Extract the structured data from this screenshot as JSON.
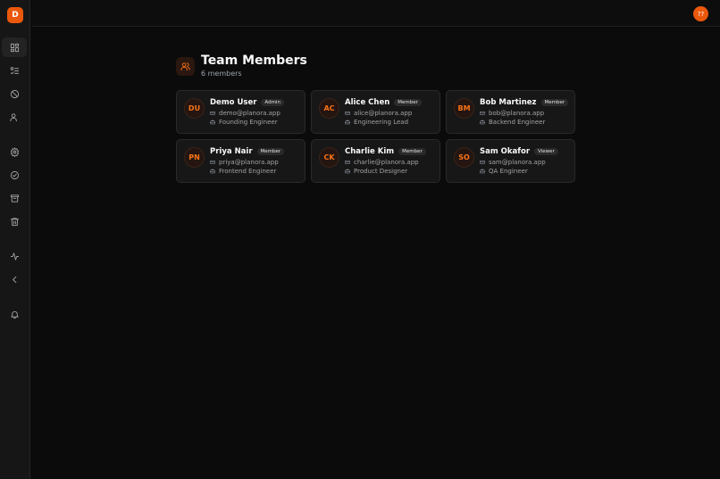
{
  "brand": {
    "logo_letter": "D"
  },
  "topbar": {
    "user_initials": "??"
  },
  "page": {
    "title": "Team Members",
    "subtitle": "6 members"
  },
  "nav": [
    {
      "icon": "dashboard-icon",
      "active": true
    },
    {
      "icon": "list-checks-icon"
    },
    {
      "icon": "ban-icon"
    },
    {
      "icon": "users-icon"
    },
    {
      "icon": "gear-icon"
    },
    {
      "icon": "check-circle-icon"
    },
    {
      "icon": "archive-icon"
    },
    {
      "icon": "trash-icon"
    },
    {
      "icon": "activity-icon"
    },
    {
      "icon": "chevron-left-icon"
    },
    {
      "icon": "bell-icon"
    }
  ],
  "members": [
    {
      "initials": "DU",
      "name": "Demo User",
      "role": "Admin",
      "email": "demo@planora.app",
      "title": "Founding Engineer"
    },
    {
      "initials": "AC",
      "name": "Alice Chen",
      "role": "Member",
      "email": "alice@planora.app",
      "title": "Engineering Lead"
    },
    {
      "initials": "BM",
      "name": "Bob Martinez",
      "role": "Member",
      "email": "bob@planora.app",
      "title": "Backend Engineer"
    },
    {
      "initials": "PN",
      "name": "Priya Nair",
      "role": "Member",
      "email": "priya@planora.app",
      "title": "Frontend Engineer"
    },
    {
      "initials": "CK",
      "name": "Charlie Kim",
      "role": "Member",
      "email": "charlie@planora.app",
      "title": "Product Designer"
    },
    {
      "initials": "SO",
      "name": "Sam Okafor",
      "role": "Viewer",
      "email": "sam@planora.app",
      "title": "QA Engineer"
    }
  ]
}
